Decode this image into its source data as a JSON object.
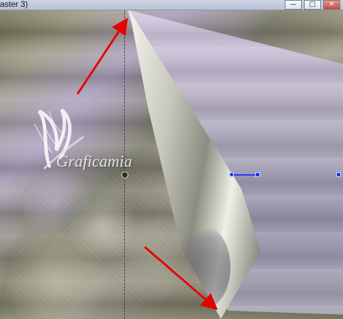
{
  "window": {
    "title": "aster 3)",
    "controls": [
      {
        "label": "—",
        "name": "minimize"
      },
      {
        "label": "□",
        "name": "maximize"
      },
      {
        "label": "✕",
        "name": "close"
      }
    ]
  },
  "watermark": {
    "text": "Graficamia"
  },
  "icons": {
    "minimize": "minimize-icon",
    "maximize": "maximize-icon",
    "close": "close-icon",
    "arrow": "red-arrow-icon"
  },
  "colors": {
    "arrow": "#e60000",
    "guide": "#1f35ff",
    "paper": "#a8a2bd"
  }
}
